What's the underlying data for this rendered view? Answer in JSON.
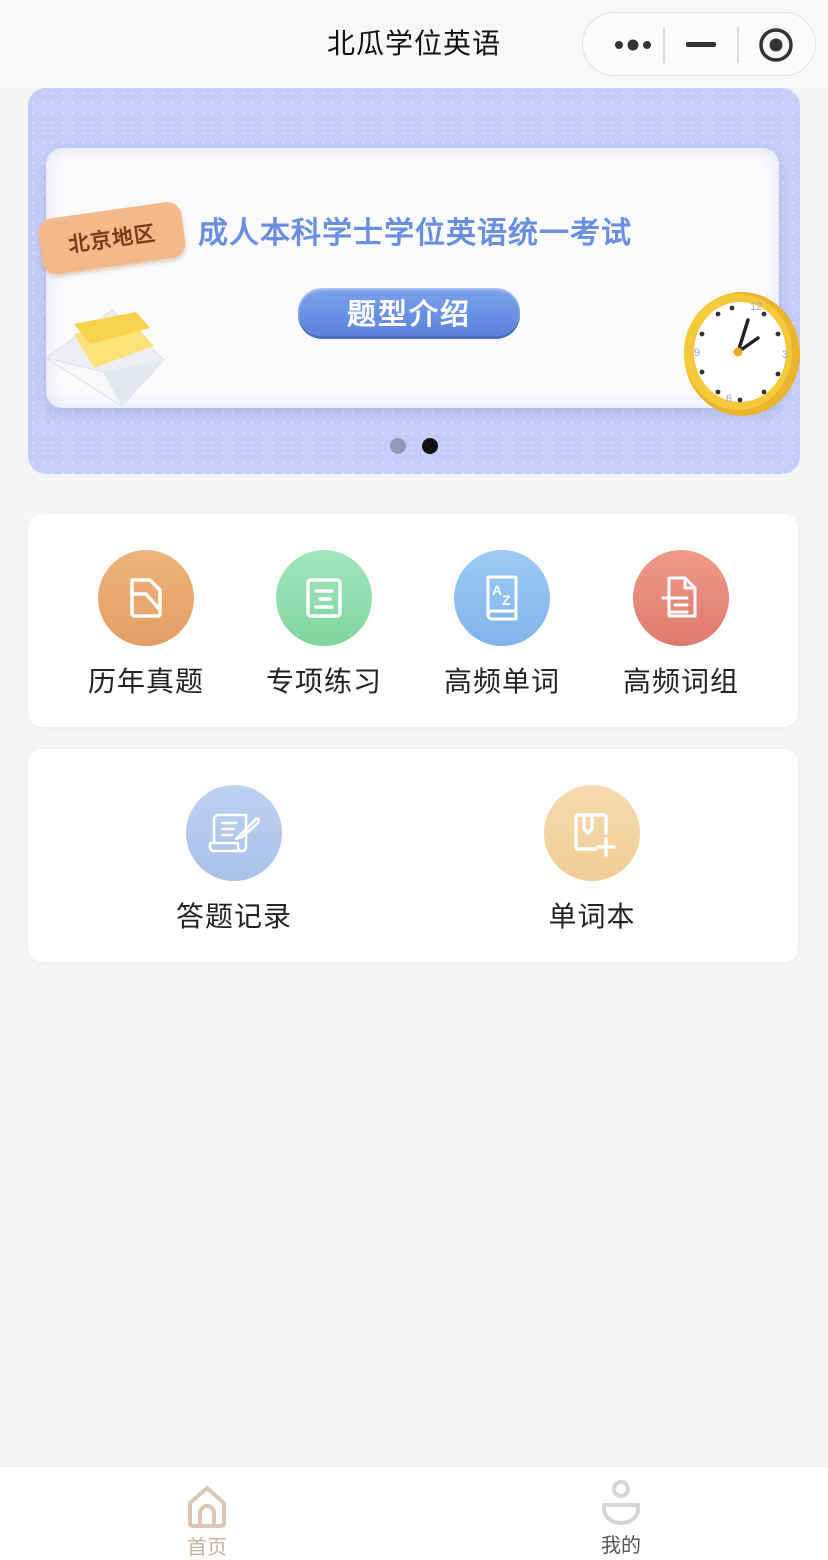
{
  "navbar": {
    "title": "北瓜学位英语",
    "capsule": {
      "more_icon": "more-dots-icon",
      "minimize_icon": "minimize-icon",
      "close_icon": "target-circle-icon"
    }
  },
  "banner": {
    "badge": "北京地区",
    "headline": "成人本科学士学位英语统一考试",
    "cta": "题型介绍",
    "pagination": {
      "count": 2,
      "active_index": 1
    }
  },
  "main_grid": {
    "items": [
      {
        "label": "历年真题",
        "icon": "folder-doc-icon",
        "color": "#e9a96b"
      },
      {
        "label": "专项练习",
        "icon": "list-doc-icon",
        "color": "#8fdcaa"
      },
      {
        "label": "高频单词",
        "icon": "az-book-icon",
        "color": "#8dbfee"
      },
      {
        "label": "高频词组",
        "icon": "doc-lines-icon",
        "color": "#ea8a7c"
      }
    ]
  },
  "secondary_grid": {
    "items": [
      {
        "label": "答题记录",
        "icon": "scroll-quill-icon",
        "color": "#b2c8ec"
      },
      {
        "label": "单词本",
        "icon": "bookmark-plus-icon",
        "color": "#f3d3a2"
      }
    ]
  },
  "tabbar": {
    "tabs": [
      {
        "label": "首页",
        "icon": "home-icon",
        "active": true,
        "color": "#c9b19b"
      },
      {
        "label": "我的",
        "icon": "person-icon",
        "active": false,
        "color": "#555555"
      }
    ]
  }
}
